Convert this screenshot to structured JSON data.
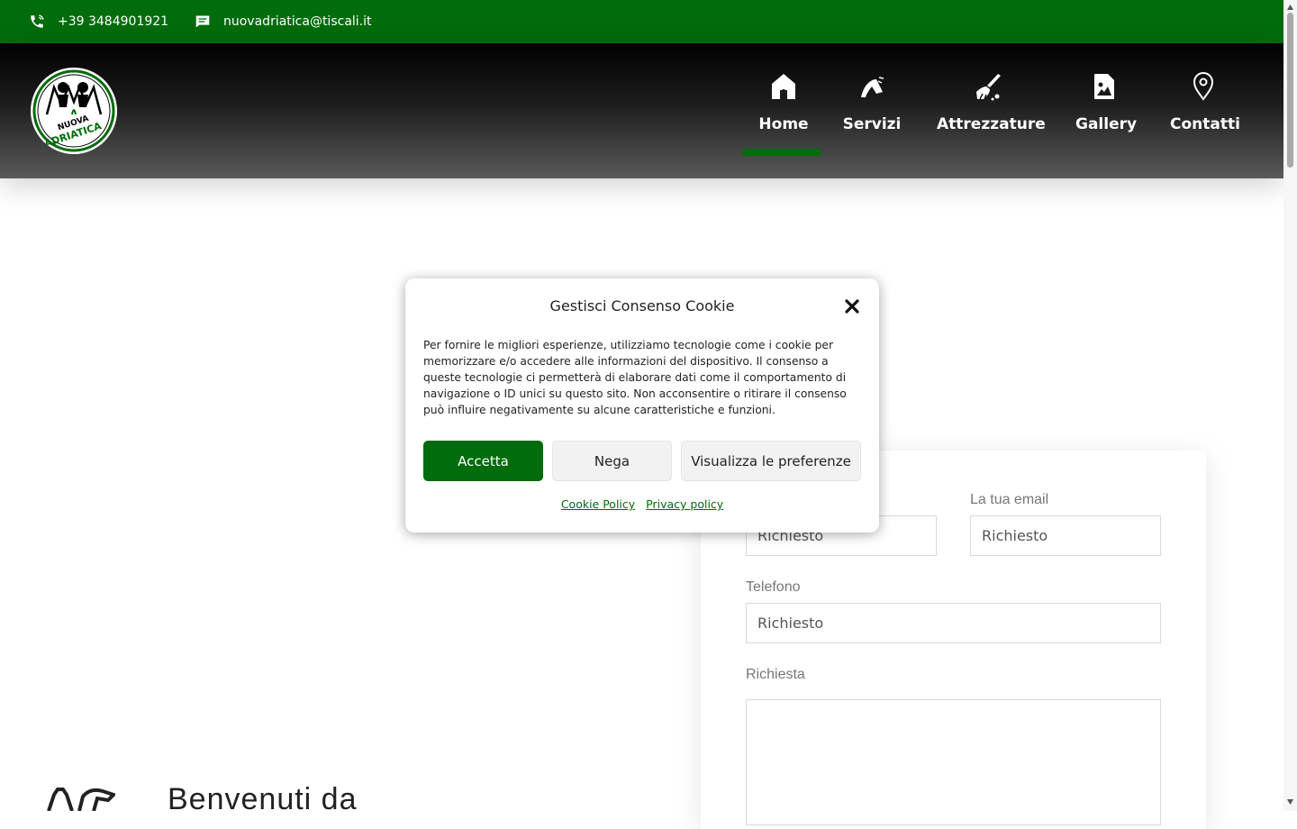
{
  "topbar": {
    "phone": "+39 3484901921",
    "email": "nuovadriatica@tiscali.it"
  },
  "logo": {
    "text": "NUOVA ADRIATICA",
    "color": "#006c0b"
  },
  "nav": {
    "items": [
      {
        "label": "Home",
        "icon": "home-icon",
        "active": true
      },
      {
        "label": "Servizi",
        "icon": "spray-icon"
      },
      {
        "label": "Attrezzature",
        "icon": "broom-icon"
      },
      {
        "label": "Gallery",
        "icon": "image-file-icon"
      },
      {
        "label": "Contatti",
        "icon": "map-pin-icon"
      }
    ]
  },
  "form": {
    "email_label": "La tua email",
    "name_placeholder": "Richiesto",
    "email_placeholder": "Richiesto",
    "phone_label": "Telefono",
    "phone_placeholder": "Richiesto",
    "request_label": "Richiesta"
  },
  "welcome": {
    "title": "Benvenuti da"
  },
  "cookie": {
    "title": "Gestisci Consenso Cookie",
    "text": "Per fornire le migliori esperienze, utilizziamo tecnologie come i cookie per memorizzare e/o accedere alle informazioni del dispositivo. Il consenso a queste tecnologie ci permetterà di elaborare dati come il comportamento di navigazione o ID unici su questo sito. Non acconsentire o ritirare il consenso può influire negativamente su alcune caratteristiche e funzioni.",
    "accept": "Accetta",
    "deny": "Nega",
    "preferences": "Visualizza le preferenze",
    "cookie_policy": "Cookie Policy",
    "privacy_policy": "Privacy policy"
  },
  "colors": {
    "brand_green": "#006c0b",
    "header_dark": "#000000"
  }
}
